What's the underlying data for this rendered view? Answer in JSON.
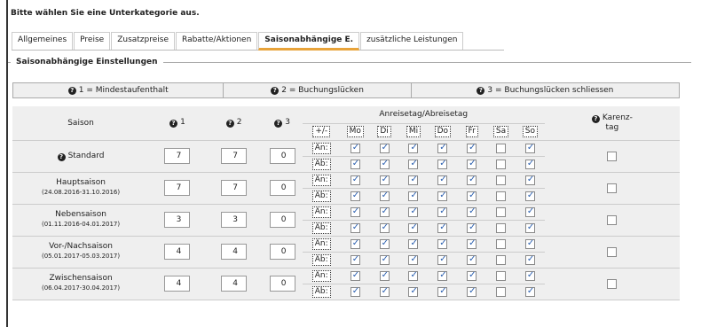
{
  "prompt": "Bitte wählen Sie eine Unterkategorie aus.",
  "tabs": [
    {
      "label": "Allgemeines",
      "active": false
    },
    {
      "label": "Preise",
      "active": false
    },
    {
      "label": "Zusatzpreise",
      "active": false
    },
    {
      "label": "Rabatte/Aktionen",
      "active": false
    },
    {
      "label": "Saisonabhängige E.",
      "active": true
    },
    {
      "label": "zusätzliche Leistungen",
      "active": false
    }
  ],
  "section_title": "Saisonabhängige Einstellungen",
  "legend": [
    "1 = Mindestaufenthalt",
    "2 = Buchungslücken",
    "3 = Buchungslücken schliessen"
  ],
  "headers": {
    "season": "Saison",
    "col1": "1",
    "col2": "2",
    "col3": "3",
    "group": "Anreisetag/Abreisetag",
    "plusminus": "+/-",
    "days": [
      "Mo",
      "Di",
      "Mi",
      "Do",
      "Fr",
      "Sa",
      "So"
    ],
    "karenz": "Karenz-\ntag"
  },
  "row_labels": {
    "an": "An:",
    "ab": "Ab:"
  },
  "seasons": [
    {
      "name": "Standard",
      "dates": "",
      "help": true,
      "v1": "7",
      "v2": "7",
      "v3": "0",
      "an": [
        true,
        true,
        true,
        true,
        true,
        false,
        true
      ],
      "ab": [
        true,
        true,
        true,
        true,
        true,
        false,
        true
      ],
      "karenz": false
    },
    {
      "name": "Hauptsaison",
      "dates": "(24.08.2016-31.10.2016)",
      "help": false,
      "v1": "7",
      "v2": "7",
      "v3": "0",
      "an": [
        true,
        true,
        true,
        true,
        true,
        false,
        true
      ],
      "ab": [
        true,
        true,
        true,
        true,
        true,
        false,
        true
      ],
      "karenz": false
    },
    {
      "name": "Nebensaison",
      "dates": "(01.11.2016-04.01.2017)",
      "help": false,
      "v1": "3",
      "v2": "3",
      "v3": "0",
      "an": [
        true,
        true,
        true,
        true,
        true,
        false,
        true
      ],
      "ab": [
        true,
        true,
        true,
        true,
        true,
        false,
        true
      ],
      "karenz": false
    },
    {
      "name": "Vor-/Nachsaison",
      "dates": "(05.01.2017-05.03.2017)",
      "help": false,
      "v1": "4",
      "v2": "4",
      "v3": "0",
      "an": [
        true,
        true,
        true,
        true,
        true,
        false,
        true
      ],
      "ab": [
        true,
        true,
        true,
        true,
        true,
        false,
        true
      ],
      "karenz": false
    },
    {
      "name": "Zwischensaison",
      "dates": "(06.04.2017-30.04.2017)",
      "help": false,
      "v1": "4",
      "v2": "4",
      "v3": "0",
      "an": [
        true,
        true,
        true,
        true,
        true,
        false,
        true
      ],
      "ab": [
        true,
        true,
        true,
        true,
        true,
        false,
        true
      ],
      "karenz": false
    }
  ]
}
